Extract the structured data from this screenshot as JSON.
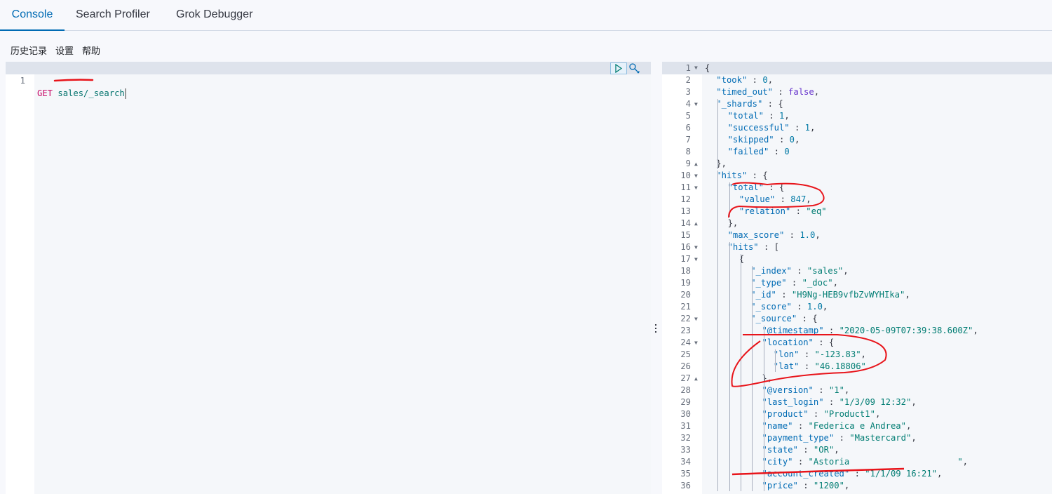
{
  "tabs": [
    {
      "label": "Console",
      "active": true
    },
    {
      "label": "Search Profiler",
      "active": false
    },
    {
      "label": "Grok Debugger",
      "active": false
    }
  ],
  "menu": {
    "history": "历史记录",
    "settings": "设置",
    "help": "帮助"
  },
  "request_editor": {
    "line_number": "1",
    "method": "GET",
    "path": "sales/_search"
  },
  "response": [
    {
      "n": "1",
      "fold": "down",
      "indent": 0,
      "text": [
        [
          "p",
          "{"
        ]
      ]
    },
    {
      "n": "2",
      "indent": 1,
      "text": [
        [
          "k",
          "\"took\""
        ],
        [
          "p",
          " : "
        ],
        [
          "n",
          "0"
        ],
        [
          "p",
          ","
        ]
      ]
    },
    {
      "n": "3",
      "indent": 1,
      "text": [
        [
          "k",
          "\"timed_out\""
        ],
        [
          "p",
          " : "
        ],
        [
          "b",
          "false"
        ],
        [
          "p",
          ","
        ]
      ]
    },
    {
      "n": "4",
      "fold": "down",
      "indent": 1,
      "text": [
        [
          "k",
          "\"_shards\""
        ],
        [
          "p",
          " : {"
        ]
      ]
    },
    {
      "n": "5",
      "indent": 2,
      "text": [
        [
          "k",
          "\"total\""
        ],
        [
          "p",
          " : "
        ],
        [
          "n",
          "1"
        ],
        [
          "p",
          ","
        ]
      ]
    },
    {
      "n": "6",
      "indent": 2,
      "text": [
        [
          "k",
          "\"successful\""
        ],
        [
          "p",
          " : "
        ],
        [
          "n",
          "1"
        ],
        [
          "p",
          ","
        ]
      ]
    },
    {
      "n": "7",
      "indent": 2,
      "text": [
        [
          "k",
          "\"skipped\""
        ],
        [
          "p",
          " : "
        ],
        [
          "n",
          "0"
        ],
        [
          "p",
          ","
        ]
      ]
    },
    {
      "n": "8",
      "indent": 2,
      "text": [
        [
          "k",
          "\"failed\""
        ],
        [
          "p",
          " : "
        ],
        [
          "n",
          "0"
        ]
      ]
    },
    {
      "n": "9",
      "fold": "up",
      "indent": 1,
      "text": [
        [
          "p",
          "},"
        ]
      ]
    },
    {
      "n": "10",
      "fold": "down",
      "indent": 1,
      "text": [
        [
          "k",
          "\"hits\""
        ],
        [
          "p",
          " : {"
        ]
      ]
    },
    {
      "n": "11",
      "fold": "down",
      "indent": 2,
      "text": [
        [
          "k",
          "\"total\""
        ],
        [
          "p",
          " : {"
        ]
      ]
    },
    {
      "n": "12",
      "indent": 3,
      "text": [
        [
          "k",
          "\"value\""
        ],
        [
          "p",
          " : "
        ],
        [
          "n",
          "847"
        ],
        [
          "p",
          ","
        ]
      ]
    },
    {
      "n": "13",
      "indent": 3,
      "text": [
        [
          "k",
          "\"relation\""
        ],
        [
          "p",
          " : "
        ],
        [
          "s",
          "\"eq\""
        ]
      ]
    },
    {
      "n": "14",
      "fold": "up",
      "indent": 2,
      "text": [
        [
          "p",
          "},"
        ]
      ]
    },
    {
      "n": "15",
      "indent": 2,
      "text": [
        [
          "k",
          "\"max_score\""
        ],
        [
          "p",
          " : "
        ],
        [
          "n",
          "1.0"
        ],
        [
          "p",
          ","
        ]
      ]
    },
    {
      "n": "16",
      "fold": "down",
      "indent": 2,
      "text": [
        [
          "k",
          "\"hits\""
        ],
        [
          "p",
          " : ["
        ]
      ]
    },
    {
      "n": "17",
      "fold": "down",
      "indent": 3,
      "text": [
        [
          "p",
          "{"
        ]
      ]
    },
    {
      "n": "18",
      "indent": 4,
      "text": [
        [
          "k",
          "\"_index\""
        ],
        [
          "p",
          " : "
        ],
        [
          "s",
          "\"sales\""
        ],
        [
          "p",
          ","
        ]
      ]
    },
    {
      "n": "19",
      "indent": 4,
      "text": [
        [
          "k",
          "\"_type\""
        ],
        [
          "p",
          " : "
        ],
        [
          "s",
          "\"_doc\""
        ],
        [
          "p",
          ","
        ]
      ]
    },
    {
      "n": "20",
      "indent": 4,
      "text": [
        [
          "k",
          "\"_id\""
        ],
        [
          "p",
          " : "
        ],
        [
          "s",
          "\"H9Ng-HEB9vfbZvWYHIka\""
        ],
        [
          "p",
          ","
        ]
      ]
    },
    {
      "n": "21",
      "indent": 4,
      "text": [
        [
          "k",
          "\"_score\""
        ],
        [
          "p",
          " : "
        ],
        [
          "n",
          "1.0"
        ],
        [
          "p",
          ","
        ]
      ]
    },
    {
      "n": "22",
      "fold": "down",
      "indent": 4,
      "text": [
        [
          "k",
          "\"_source\""
        ],
        [
          "p",
          " : {"
        ]
      ]
    },
    {
      "n": "23",
      "indent": 5,
      "text": [
        [
          "k",
          "\"@timestamp\""
        ],
        [
          "p",
          " : "
        ],
        [
          "s",
          "\"2020-05-09T07:39:38.600Z\""
        ],
        [
          "p",
          ","
        ]
      ]
    },
    {
      "n": "24",
      "fold": "down",
      "indent": 5,
      "text": [
        [
          "k",
          "\"location\""
        ],
        [
          "p",
          " : {"
        ]
      ]
    },
    {
      "n": "25",
      "indent": 6,
      "text": [
        [
          "k",
          "\"lon\""
        ],
        [
          "p",
          " : "
        ],
        [
          "s",
          "\"-123.83\""
        ],
        [
          "p",
          ","
        ]
      ]
    },
    {
      "n": "26",
      "indent": 6,
      "text": [
        [
          "k",
          "\"lat\""
        ],
        [
          "p",
          " : "
        ],
        [
          "s",
          "\"46.18806\""
        ]
      ]
    },
    {
      "n": "27",
      "fold": "up",
      "indent": 5,
      "text": [
        [
          "p",
          "},"
        ]
      ]
    },
    {
      "n": "28",
      "indent": 5,
      "text": [
        [
          "k",
          "\"@version\""
        ],
        [
          "p",
          " : "
        ],
        [
          "s",
          "\"1\""
        ],
        [
          "p",
          ","
        ]
      ]
    },
    {
      "n": "29",
      "indent": 5,
      "text": [
        [
          "k",
          "\"last_login\""
        ],
        [
          "p",
          " : "
        ],
        [
          "s",
          "\"1/3/09 12:32\""
        ],
        [
          "p",
          ","
        ]
      ]
    },
    {
      "n": "30",
      "indent": 5,
      "text": [
        [
          "k",
          "\"product\""
        ],
        [
          "p",
          " : "
        ],
        [
          "s",
          "\"Product1\""
        ],
        [
          "p",
          ","
        ]
      ]
    },
    {
      "n": "31",
      "indent": 5,
      "text": [
        [
          "k",
          "\"name\""
        ],
        [
          "p",
          " : "
        ],
        [
          "s",
          "\"Federica e Andrea\""
        ],
        [
          "p",
          ","
        ]
      ]
    },
    {
      "n": "32",
      "indent": 5,
      "text": [
        [
          "k",
          "\"payment_type\""
        ],
        [
          "p",
          " : "
        ],
        [
          "s",
          "\"Mastercard\""
        ],
        [
          "p",
          ","
        ]
      ]
    },
    {
      "n": "33",
      "indent": 5,
      "text": [
        [
          "k",
          "\"state\""
        ],
        [
          "p",
          " : "
        ],
        [
          "s",
          "\"OR\""
        ],
        [
          "p",
          ","
        ]
      ]
    },
    {
      "n": "34",
      "indent": 5,
      "text": [
        [
          "k",
          "\"city\""
        ],
        [
          "p",
          " : "
        ],
        [
          "s",
          "\"Astoria                     \""
        ],
        [
          "p",
          ","
        ]
      ]
    },
    {
      "n": "35",
      "indent": 5,
      "text": [
        [
          "k",
          "\"account_created\""
        ],
        [
          "p",
          " : "
        ],
        [
          "s",
          "\"1/1/09 16:21\""
        ],
        [
          "p",
          ","
        ]
      ]
    },
    {
      "n": "36",
      "indent": 5,
      "text": [
        [
          "k",
          "\"price\""
        ],
        [
          "p",
          " : "
        ],
        [
          "s",
          "\"1200\""
        ],
        [
          "p",
          ","
        ]
      ]
    }
  ]
}
